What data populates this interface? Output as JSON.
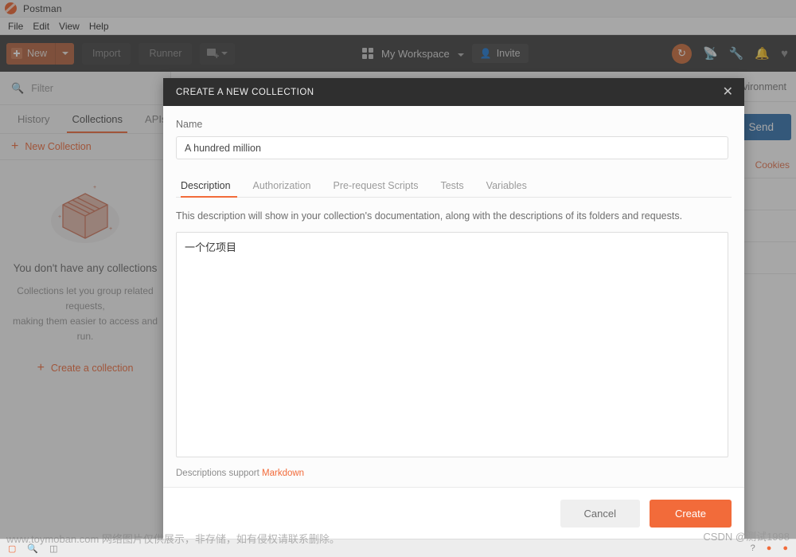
{
  "window": {
    "title": "Postman",
    "logo_icon": "postman-logo-icon"
  },
  "menubar": {
    "items": [
      "File",
      "Edit",
      "View",
      "Help"
    ]
  },
  "toolbar": {
    "new_label": "New",
    "new_icon": "plus-square-icon",
    "new_caret_icon": "chevron-down-icon",
    "import_label": "Import",
    "runner_label": "Runner",
    "new_tab_icon": "new-tab-icon",
    "new_tab_caret_icon": "chevron-down-icon",
    "workspace_icon": "grid-icon",
    "workspace_label": "My Workspace",
    "workspace_caret_icon": "chevron-down-icon",
    "invite_label": "Invite",
    "invite_icon": "person-add-icon",
    "sync_icon": "sync-icon",
    "right_icons": [
      "satellite-icon",
      "wrench-icon",
      "bell-icon",
      "heart-icon"
    ],
    "accent_color": "#f26b3a",
    "sync_color": "#cd6a37",
    "background_color": "#3b3b3b"
  },
  "sidebar": {
    "search_icon": "search-icon",
    "filter_placeholder": "Filter",
    "tabs": [
      {
        "label": "History",
        "active": false
      },
      {
        "label": "Collections",
        "active": true
      },
      {
        "label": "APIs",
        "active": false
      }
    ],
    "new_collection_label": "New Collection",
    "new_collection_icon": "plus-icon",
    "empty_state": {
      "illustration_icon": "empty-box-icon",
      "title": "You don't have any collections",
      "description_line1": "Collections let you group related requests,",
      "description_line2": "making them easier to access and run.",
      "cta_label": "Create a collection",
      "cta_icon": "plus-icon"
    }
  },
  "main": {
    "environment_label": "No Environment",
    "send_label": "Send",
    "cookies_label": "Cookies",
    "send_color": "#2f6fad"
  },
  "modal": {
    "title": "CREATE A NEW COLLECTION",
    "close_icon": "close-icon",
    "name_label": "Name",
    "name_value": "A hundred million",
    "name_placeholder": "Name",
    "tabs": [
      {
        "label": "Description",
        "active": true
      },
      {
        "label": "Authorization",
        "active": false
      },
      {
        "label": "Pre-request Scripts",
        "active": false
      },
      {
        "label": "Tests",
        "active": false
      },
      {
        "label": "Variables",
        "active": false
      }
    ],
    "description_hint": "This description will show in your collection's documentation, along with the descriptions of its folders and requests.",
    "description_value": "一个亿项目",
    "description_placeholder": "Description",
    "markdown_prefix": "Descriptions support",
    "markdown_link": "Markdown",
    "cancel_label": "Cancel",
    "create_label": "Create",
    "create_color": "#f26b3a"
  },
  "watermarks": {
    "toymoban": "www.toymoban.com 网络图片仅供展示，非存储，如有侵权请联系删除。",
    "csdn": "CSDN @测试1998"
  }
}
